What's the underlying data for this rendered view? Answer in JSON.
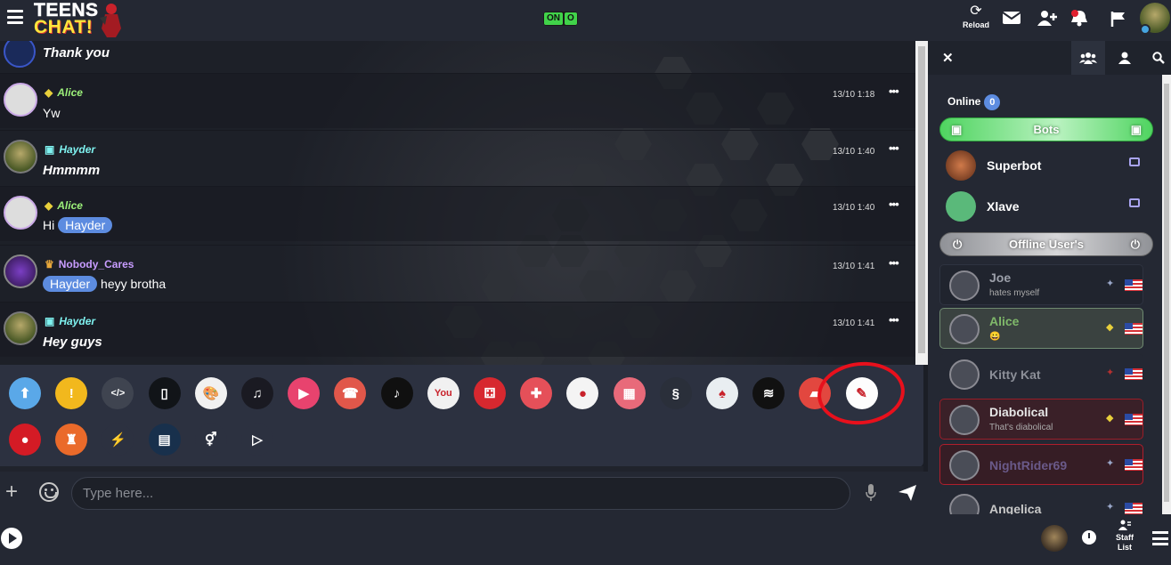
{
  "topbar": {
    "logo_line1": "TEENS",
    "logo_line2": "CHAT!",
    "status_badge": [
      "ON",
      "O"
    ],
    "reload_label": "Reload"
  },
  "chat": {
    "messages": [
      {
        "name": "",
        "text": "Thank you",
        "time": "",
        "style": "big"
      },
      {
        "name": "Alice",
        "rank": "diamond-icon",
        "text": "Yw",
        "time": "13/10 1:18",
        "name_color": "#9cf07a"
      },
      {
        "name": "Hayder",
        "rank": "terminal-icon",
        "text": "Hmmmm",
        "time": "13/10 1:40",
        "name_color": "#7ff2f0",
        "style": "big"
      },
      {
        "name": "Alice",
        "rank": "diamond-icon",
        "text_before": "Hi",
        "mention": "Hayder",
        "time": "13/10 1:40",
        "name_color": "#9cf07a"
      },
      {
        "name": "Nobody_Cares",
        "rank": "crown-icon",
        "mention": "Hayder",
        "text_after": "heyy brotha",
        "time": "13/10 1:41",
        "name_color": "#c89cff"
      },
      {
        "name": "Hayder",
        "rank": "terminal-icon",
        "text": "Hey guys",
        "time": "13/10 1:41",
        "name_color": "#7ff2f0",
        "style": "big"
      }
    ],
    "more_label": "•••"
  },
  "apps": {
    "row1": [
      {
        "name": "upload-app-icon",
        "glyph": "⬆",
        "bg": "#5aa8e8"
      },
      {
        "name": "coin-app-icon",
        "glyph": "!",
        "bg": "#f2b81d"
      },
      {
        "name": "code-app-icon",
        "glyph": "</>",
        "bg": "#3f4450"
      },
      {
        "name": "giphy-app-icon",
        "glyph": "▯",
        "bg": "#111418"
      },
      {
        "name": "paint-app-icon",
        "glyph": "🎨",
        "bg": "#f1f1f1"
      },
      {
        "name": "music-app-icon",
        "glyph": "♫",
        "bg": "#1a1a22"
      },
      {
        "name": "video-app-icon",
        "glyph": "▶",
        "bg": "#e8436e"
      },
      {
        "name": "phone-app-icon",
        "glyph": "☎",
        "bg": "#e1574a"
      },
      {
        "name": "tiktok-app-icon",
        "glyph": "♪",
        "bg": "#101010"
      },
      {
        "name": "youtube-app-icon",
        "glyph": "You",
        "bg": "#f1f1f1"
      },
      {
        "name": "dice-app-icon",
        "glyph": "⚃",
        "bg": "#d7282f"
      },
      {
        "name": "gamepad-app-icon",
        "glyph": "✚",
        "bg": "#e55059"
      },
      {
        "name": "candy-app-icon",
        "glyph": "●",
        "bg": "#f4f4f4"
      },
      {
        "name": "grid-game-app-icon",
        "glyph": "▦",
        "bg": "#e86a7a"
      },
      {
        "name": "snake-app-icon",
        "glyph": "§",
        "bg": "#2a2f3a"
      },
      {
        "name": "cards-app-icon",
        "glyph": "♠",
        "bg": "#e9eef1"
      },
      {
        "name": "spotify-app-icon",
        "glyph": "≋",
        "bg": "#111"
      },
      {
        "name": "notes-app-icon",
        "glyph": "▰",
        "bg": "#e2473f"
      },
      {
        "name": "crossword-app-icon",
        "glyph": "✎",
        "bg": "#fdfdfd"
      }
    ],
    "row2": [
      {
        "name": "record-app-icon",
        "glyph": "●",
        "bg": "#d41b25"
      },
      {
        "name": "chess-app-icon",
        "glyph": "♜",
        "bg": "#ea6a2a"
      },
      {
        "name": "lightning-app-icon",
        "glyph": "⚡",
        "bg": "#2c3140"
      },
      {
        "name": "poster-app-icon",
        "glyph": "▤",
        "bg": "#18304c"
      },
      {
        "name": "gender-app-icon",
        "glyph": "⚥",
        "bg": "#2c3140"
      },
      {
        "name": "player-app-icon",
        "glyph": "▷",
        "bg": "#2c3140"
      }
    ]
  },
  "input": {
    "placeholder": "Type here..."
  },
  "sidebar": {
    "online_label": "Online",
    "online_count": "0",
    "bots_label": "Bots",
    "offline_label": "Offline User's",
    "bots": [
      {
        "name": "Superbot",
        "bg": "#8a4a2a"
      },
      {
        "name": "Xlave",
        "bg": "#5ab97a"
      }
    ],
    "offline_users": [
      {
        "name": "Joe",
        "status": "hates myself",
        "rank": "✦",
        "rank_color": "#9aa7c9",
        "name_color": "#9ca0aa",
        "card_bg": "#20242e",
        "card_border": "#2e3340"
      },
      {
        "name": "Alice",
        "status": "😀",
        "rank": "◆",
        "rank_color": "#e8cf3b",
        "name_color": "#7fb86a",
        "card_bg": "#3a4240",
        "card_border": "#6f8a70"
      },
      {
        "name": "Kitty Kat",
        "status": "",
        "rank": "✦",
        "rank_color": "#b43030",
        "name_color": "#8c8f98",
        "card_bg": "#242833",
        "card_border": "#242833"
      },
      {
        "name": "Diabolical",
        "status": "That's diabolical",
        "rank": "◆",
        "rank_color": "#e8cf3b",
        "name_color": "#e6e6e6",
        "card_bg": "#3a2028",
        "card_border": "#9a1d28"
      },
      {
        "name": "NightRider69",
        "status": "",
        "rank": "✦",
        "rank_color": "#9aa7c9",
        "name_color": "#6a5a8a",
        "card_bg": "#361d25",
        "card_border": "#b01e2c"
      },
      {
        "name": "Angelica",
        "status": "",
        "rank": "✦",
        "rank_color": "#9aa7c9",
        "name_color": "#c8c8c8",
        "card_bg": "#242833",
        "card_border": "#242833"
      }
    ]
  },
  "bottombar": {
    "staff_label_1": "Staff",
    "staff_label_2": "List"
  }
}
